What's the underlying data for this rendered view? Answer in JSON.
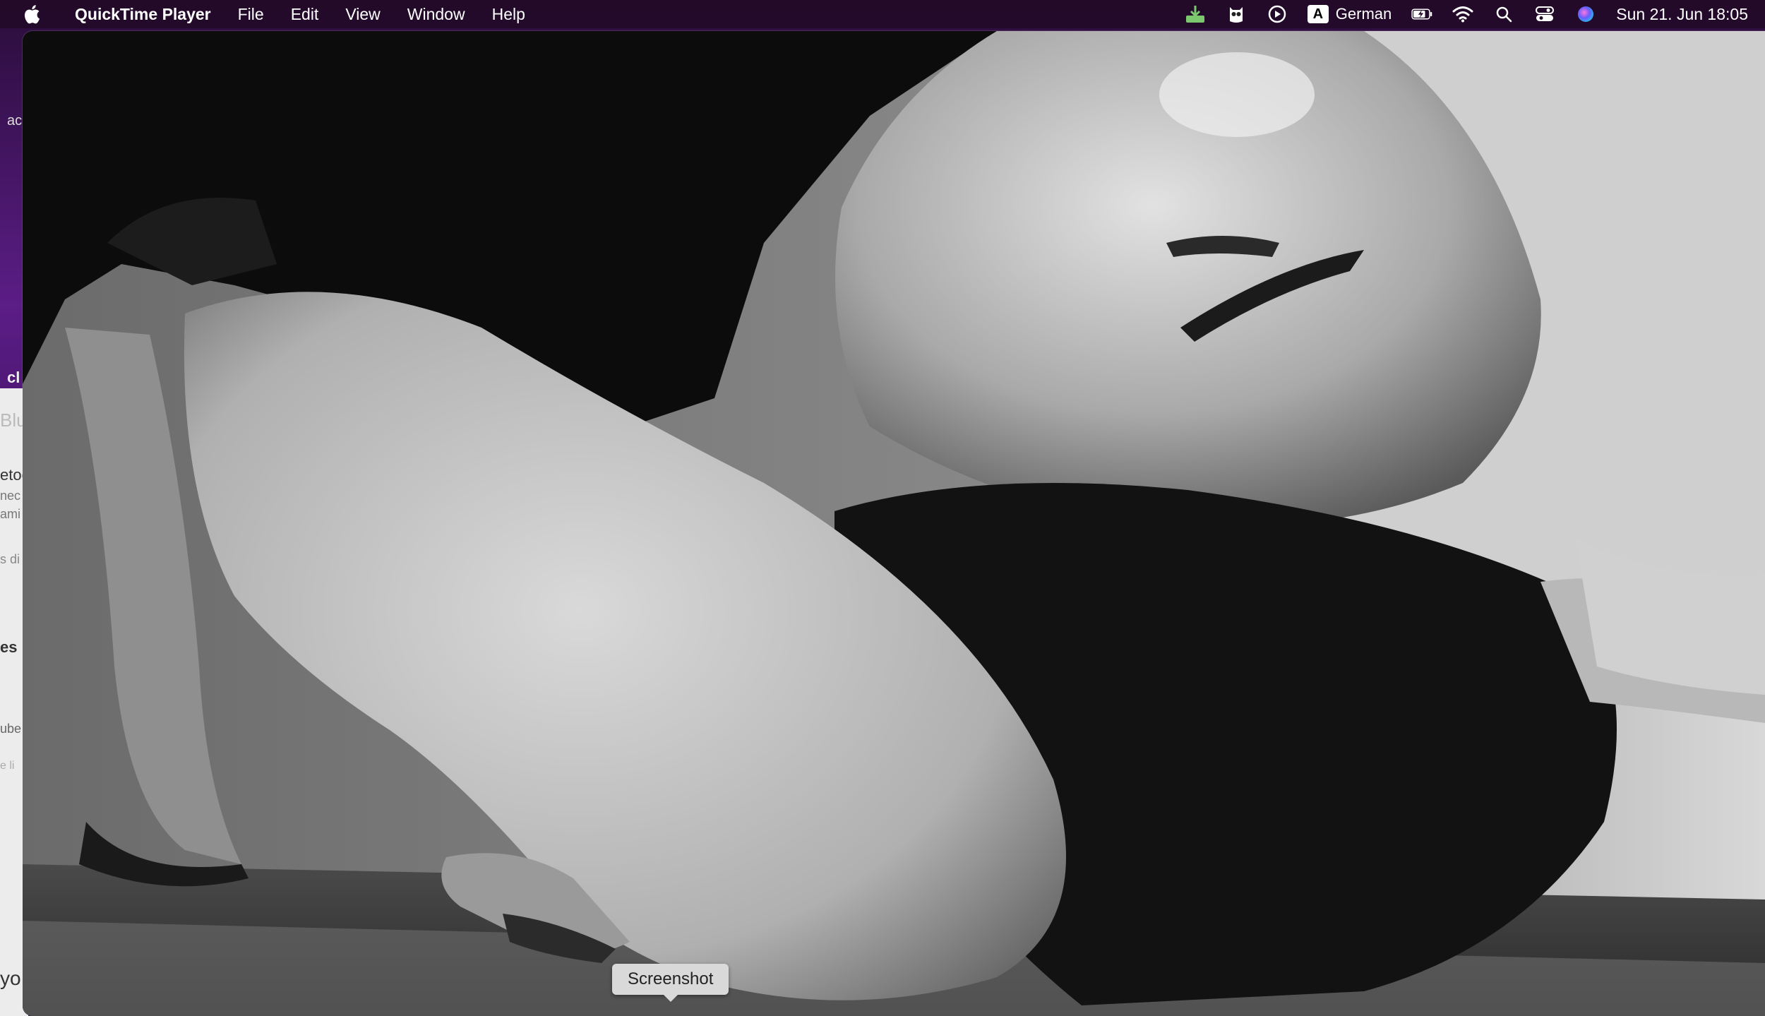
{
  "menubar": {
    "app_name": "QuickTime Player",
    "menus": [
      "File",
      "Edit",
      "View",
      "Window",
      "Help"
    ],
    "input_source_letter": "A",
    "input_source_label": "German",
    "clock": "Sun 21. Jun  18:05"
  },
  "background_window": {
    "fragments": [
      "ac",
      "cl",
      "Blu",
      "etoo",
      "nec",
      "ami",
      "s di",
      "es",
      "ube",
      "e li",
      "yo"
    ]
  },
  "video": {
    "description_icon": "video-frame"
  },
  "tooltip": {
    "label": "Screenshot"
  },
  "colors": {
    "menubar_bg": "#230a28",
    "tooltip_bg": "#d9d9d9"
  }
}
